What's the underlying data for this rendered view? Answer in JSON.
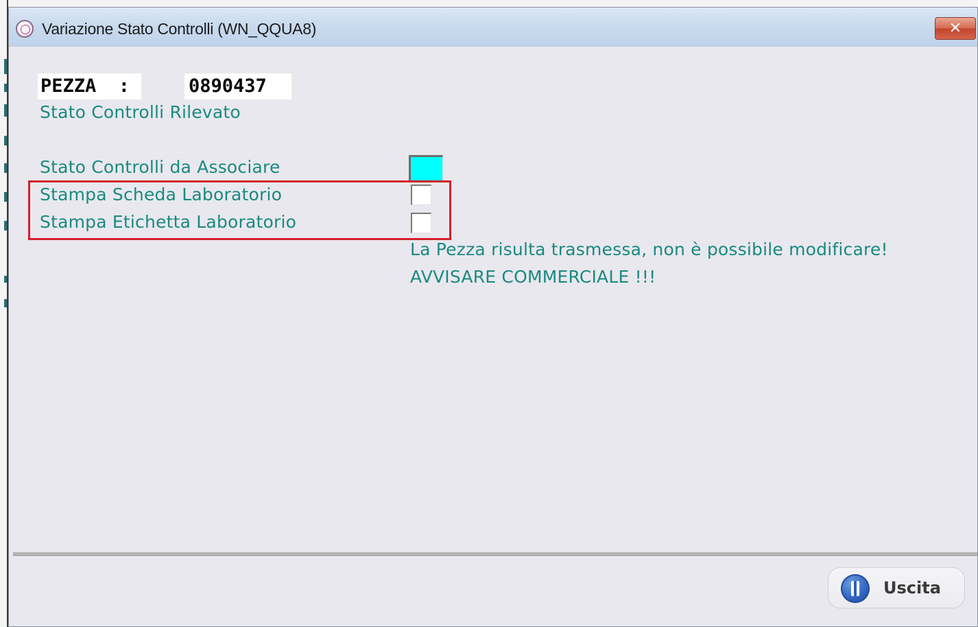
{
  "window": {
    "title": "Variazione Stato Controlli (WN_QQUA8)",
    "close_label": "✕"
  },
  "form": {
    "pezza_label": "PEZZA  :",
    "pezza_value": "0890437",
    "stato_rilevato_label": "Stato Controlli Rilevato",
    "stato_associare_label": "Stato Controlli da Associare",
    "stato_associare_color": "#00ffff",
    "stampa_scheda_label": "Stampa Scheda Laboratorio",
    "stampa_scheda_checked": false,
    "stampa_etichetta_label": "Stampa Etichetta Laboratorio",
    "stampa_etichetta_checked": false,
    "warning_line1": "La Pezza risulta trasmessa, non è possibile modificare!",
    "warning_line2": "AVVISARE COMMERCIALE !!!"
  },
  "footer": {
    "exit_label": "Uscita"
  },
  "colors": {
    "label_teal": "#1a8a80",
    "highlight_red": "#d4202c",
    "close_red": "#c3452d"
  }
}
